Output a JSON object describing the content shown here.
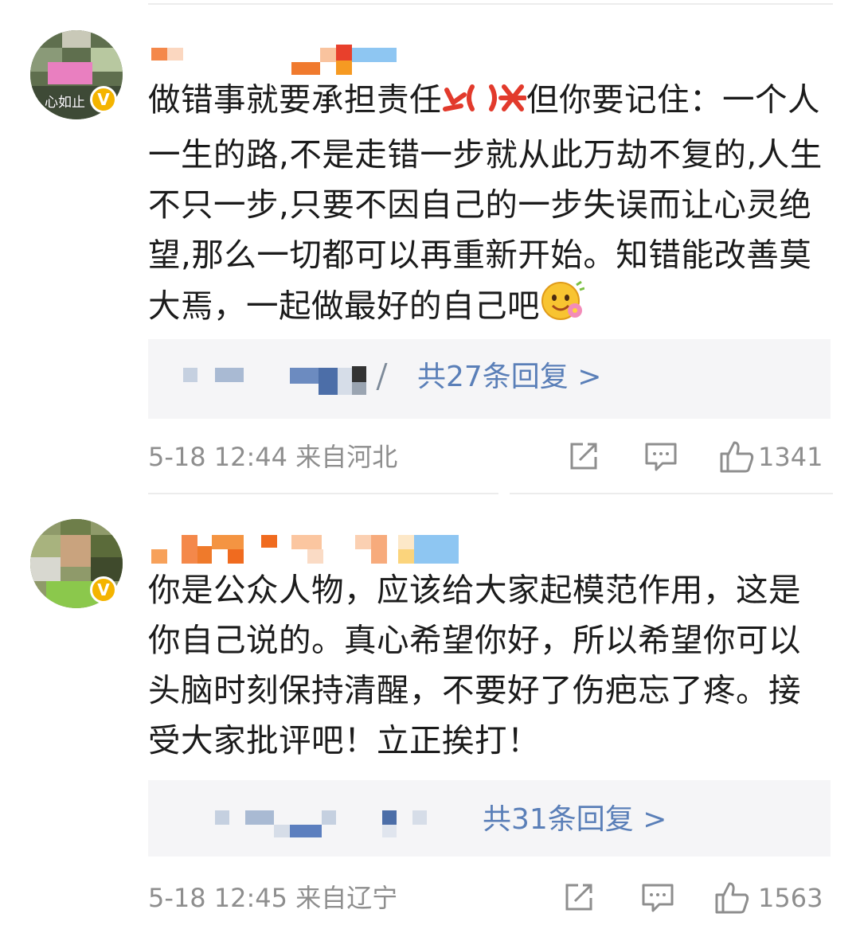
{
  "comments": [
    {
      "avatar_caption": "心如止",
      "verified_badge": "V",
      "text": "做错事就要承担责任",
      "text_rest": "但你要记住：一个人一生的路,不是走错一步就从此万劫不复的,人生不只一步,只要不因自己的一步失误而让心灵绝望,那么一切都可以再重新开始。知错能改善莫大焉，一起做最好的自己吧",
      "reply_count_label": "共27条回复 >",
      "time": "5-18 12:44",
      "location": "来自河北",
      "likes": "1341",
      "icons": [
        "angry-emoji-icon",
        "hugging-emoji-icon",
        "share-icon",
        "comment-icon",
        "like-icon"
      ]
    },
    {
      "avatar_caption": "",
      "verified_badge": "V",
      "text": "你是公众人物，应该给大家起模范作用，这是你自己说的。真心希望你好，所以希望你可以头脑时刻保持清醒，不要好了伤疤忘了疼。接受大家批评吧！立正挨打！",
      "reply_count_label": "共31条回复 >",
      "time": "5-18 12:45",
      "location": "来自辽宁",
      "likes": "1563",
      "icons": [
        "share-icon",
        "comment-icon",
        "like-icon"
      ]
    }
  ],
  "colors": {
    "link_blue": "#5a7fb8",
    "meta_gray": "#8e8e8e",
    "reply_bg": "#f5f5f7",
    "verified_gold": "#f4b400"
  }
}
